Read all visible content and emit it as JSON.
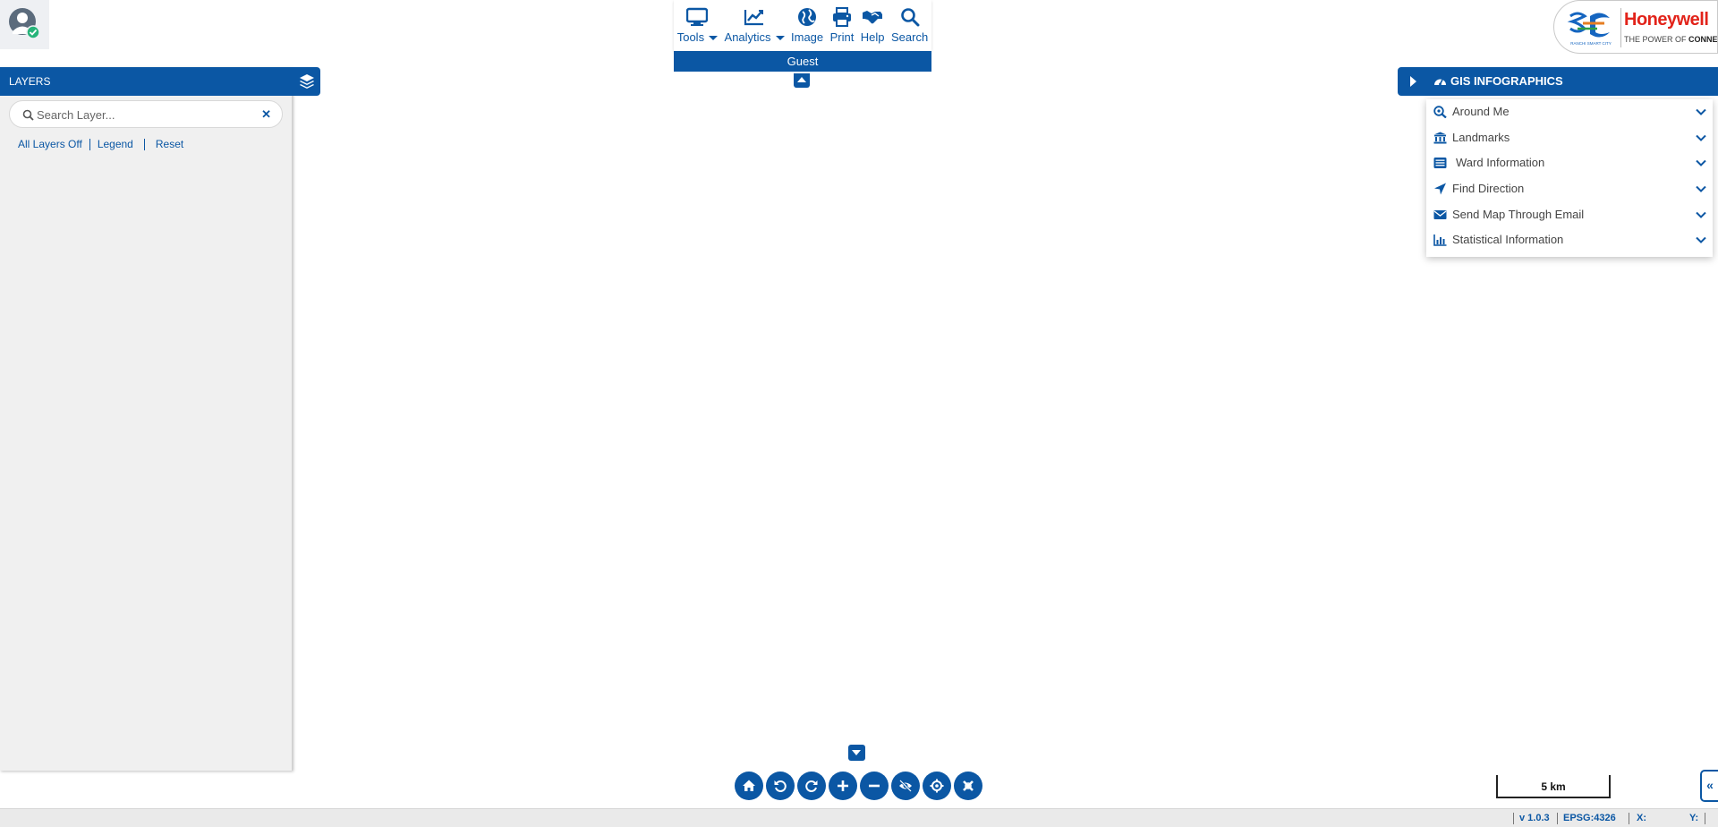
{
  "toolbar": {
    "items": [
      {
        "label": "Tools",
        "icon": "desktop-icon",
        "dropdown": true
      },
      {
        "label": "Analytics",
        "icon": "line-chart-icon",
        "dropdown": true
      },
      {
        "label": "Image",
        "icon": "globe-icon",
        "dropdown": false
      },
      {
        "label": "Print",
        "icon": "printer-icon",
        "dropdown": false
      },
      {
        "label": "Help",
        "icon": "handshake-icon",
        "dropdown": false
      },
      {
        "label": "Search",
        "icon": "search-icon",
        "dropdown": false
      }
    ],
    "user_label": "Guest"
  },
  "logo": {
    "partner_name": "Honeywell",
    "tagline_prefix": "THE POWER OF",
    "tagline_bold": "CONNECTED",
    "city_caption": "RANCHI SMART CITY"
  },
  "layers": {
    "title": "LAYERS",
    "search_placeholder": "Search Layer...",
    "search_value": "",
    "links": {
      "all_off": "All Layers Off",
      "legend": "Legend",
      "reset": "Reset"
    }
  },
  "infographics": {
    "title": "GIS INFOGRAPHICS",
    "items": [
      {
        "label": "Around Me",
        "icon": "search-location-icon"
      },
      {
        "label": "Landmarks",
        "icon": "landmark-icon"
      },
      {
        "label": "Ward Information",
        "icon": "ward-building-icon"
      },
      {
        "label": "Find Direction",
        "icon": "location-arrow-icon"
      },
      {
        "label": "Send Map Through Email",
        "icon": "envelope-icon"
      },
      {
        "label": "Statistical Information",
        "icon": "bar-chart-icon"
      }
    ]
  },
  "map_controls": [
    "home-icon",
    "undo-icon",
    "redo-icon",
    "zoom-in-icon",
    "zoom-out-icon",
    "hide-icon",
    "locate-icon",
    "clear-icon"
  ],
  "scale": {
    "label": "5 km"
  },
  "expand_tab": {
    "label": "«"
  },
  "status": {
    "version": "v 1.0.3",
    "projection": "EPSG:4326",
    "x_label": "X:",
    "x_value": "",
    "y_label": "Y:",
    "y_value": ""
  },
  "colors": {
    "primary": "#0b57a4",
    "panel_bg": "#f0f0f0",
    "brand_red": "#e2231a"
  }
}
